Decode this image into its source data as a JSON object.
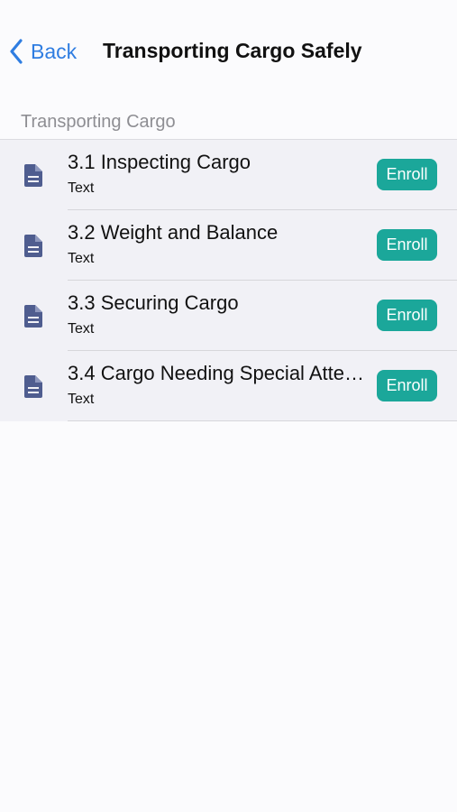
{
  "nav": {
    "back_label": "Back",
    "title": "Transporting Cargo Safely"
  },
  "section": {
    "header": "Transporting Cargo"
  },
  "lessons": [
    {
      "title": "3.1 Inspecting Cargo",
      "type": "Text",
      "action": "Enroll",
      "icon": "document-icon"
    },
    {
      "title": "3.2 Weight and Balance",
      "type": "Text",
      "action": "Enroll",
      "icon": "document-icon"
    },
    {
      "title": "3.3 Securing Cargo",
      "type": "Text",
      "action": "Enroll",
      "icon": "document-icon"
    },
    {
      "title": "3.4 Cargo Needing Special Attention",
      "type": "Text",
      "action": "Enroll",
      "icon": "document-icon"
    }
  ],
  "colors": {
    "accent": "#2f7de1",
    "enroll": "#1ba79a",
    "icon": "#4f5d8f"
  }
}
